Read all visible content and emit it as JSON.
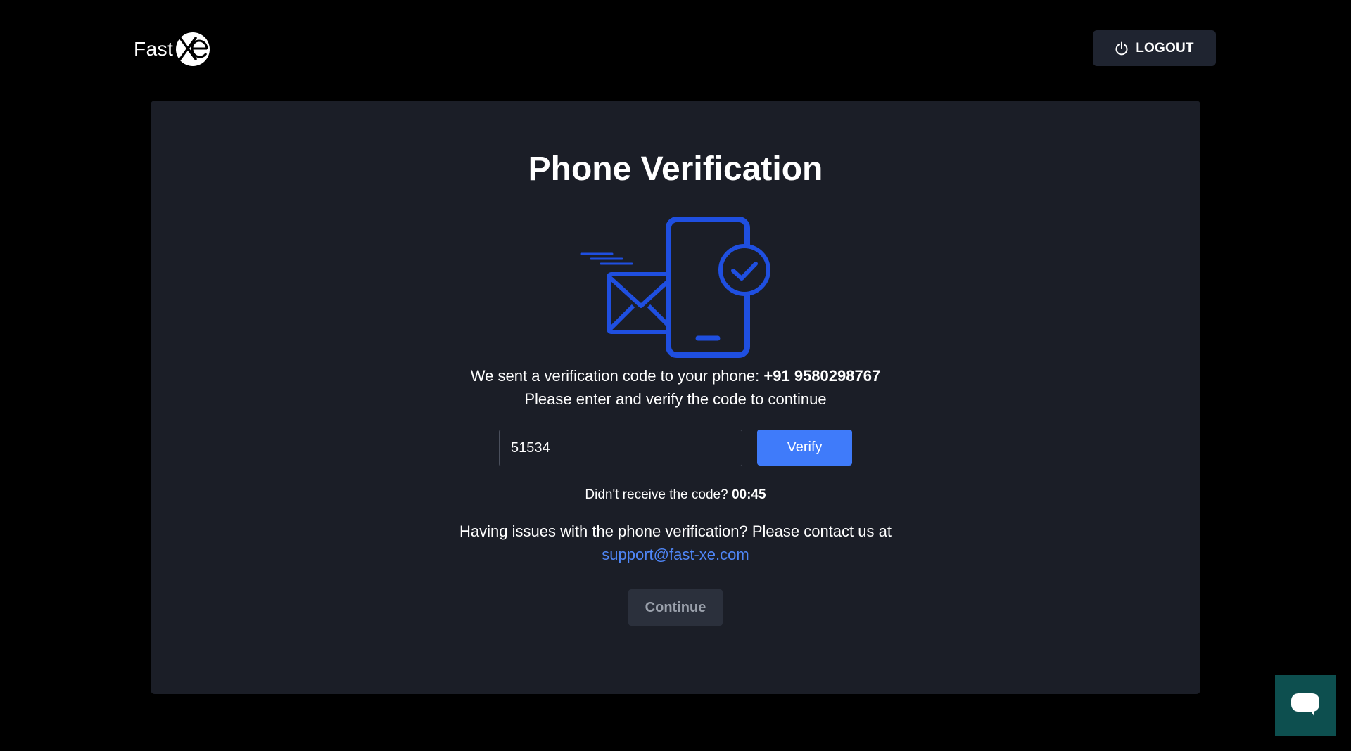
{
  "header": {
    "logo_text": "Fast",
    "logo_mark_text": "xe",
    "logout_label": "LOGOUT"
  },
  "main": {
    "title": "Phone Verification",
    "message_prefix": "We sent a verification code to your phone: ",
    "phone_number": "+91 9580298767",
    "message_line2": "Please enter and verify the code to continue",
    "code_input_value": "51534",
    "verify_label": "Verify",
    "resend_prefix": "Didn't receive the code? ",
    "resend_timer": "00:45",
    "issues_text": "Having issues with the phone verification? Please contact us at",
    "support_email": "support@fast-xe.com",
    "continue_label": "Continue"
  },
  "icons": {
    "logout": "power-icon",
    "illustration": "phone-verification-illustration",
    "chat": "chat-bubble-icon"
  },
  "colors": {
    "accent": "#3f7bfa",
    "link": "#4f86f7",
    "illustration": "#1f4fe0",
    "card_bg": "#1b1e27",
    "chat_bg": "#0d4f4f"
  }
}
